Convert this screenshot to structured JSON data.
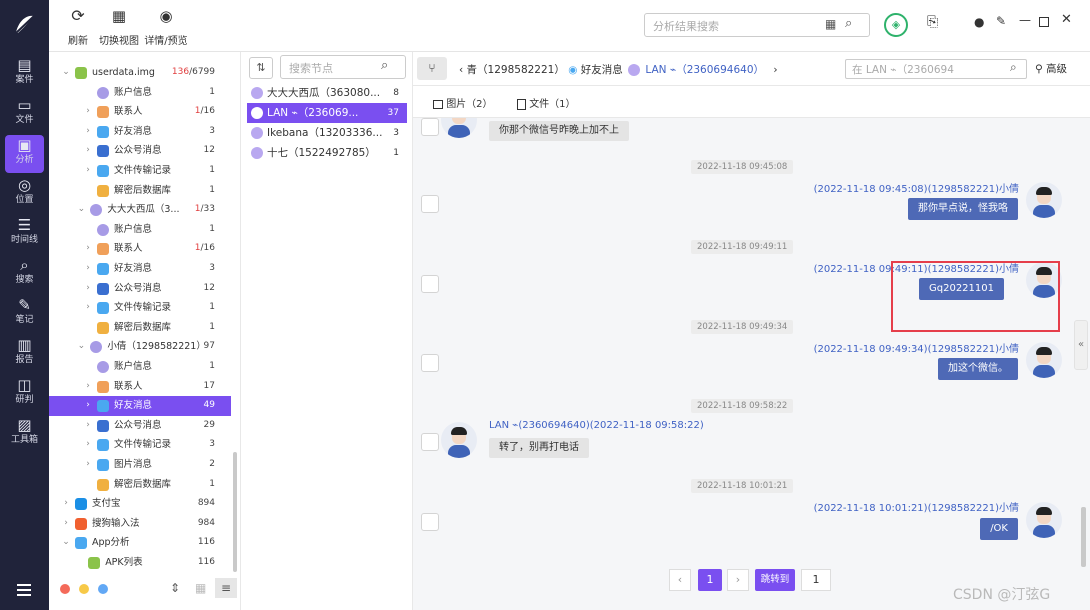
{
  "leftbar": {
    "items": [
      {
        "icon": "case-icon",
        "label": "案件"
      },
      {
        "icon": "file-icon",
        "label": "文件"
      },
      {
        "icon": "analysis-icon",
        "label": "分析"
      },
      {
        "icon": "location-icon",
        "label": "位置"
      },
      {
        "icon": "timeline-icon",
        "label": "时间线"
      },
      {
        "icon": "search-icon",
        "label": "搜索"
      },
      {
        "icon": "note-icon",
        "label": "笔记"
      },
      {
        "icon": "report-icon",
        "label": "报告"
      },
      {
        "icon": "judge-icon",
        "label": "研判"
      },
      {
        "icon": "toolbox-icon",
        "label": "工具箱"
      }
    ],
    "active_index": 2
  },
  "toolbar": {
    "refresh_label": "刷新",
    "switch_view_label": "切换视图",
    "detail_preview_label": "详情/预览",
    "search_placeholder": "分析结果搜索"
  },
  "tree": {
    "rows": [
      {
        "level": 0,
        "arrow": "v",
        "icon": "android",
        "text": "userdata.img",
        "cnt_red": "136",
        "cnt": "/6799"
      },
      {
        "level": 1,
        "arrow": "",
        "icon": "user",
        "text": "账户信息",
        "cnt": "1"
      },
      {
        "level": 1,
        "arrow": ">",
        "icon": "contact",
        "text": "联系人",
        "cnt_red": "1",
        "cnt": "/16"
      },
      {
        "level": 1,
        "arrow": ">",
        "icon": "chat",
        "text": "好友消息",
        "cnt": "3"
      },
      {
        "level": 1,
        "arrow": ">",
        "icon": "official",
        "text": "公众号消息",
        "cnt": "12"
      },
      {
        "level": 1,
        "arrow": ">",
        "icon": "chat",
        "text": "文件传输记录",
        "cnt": "1"
      },
      {
        "level": 1,
        "arrow": "",
        "icon": "db",
        "text": "解密后数据库",
        "cnt": "1"
      },
      {
        "level": 0.7,
        "arrow": "v",
        "icon": "user",
        "text": "大大大西瓜（3...",
        "cnt_red": "1",
        "cnt": "/33"
      },
      {
        "level": 1,
        "arrow": "",
        "icon": "user",
        "text": "账户信息",
        "cnt": "1"
      },
      {
        "level": 1,
        "arrow": ">",
        "icon": "contact",
        "text": "联系人",
        "cnt_red": "1",
        "cnt": "/16"
      },
      {
        "level": 1,
        "arrow": ">",
        "icon": "chat",
        "text": "好友消息",
        "cnt": "3"
      },
      {
        "level": 1,
        "arrow": ">",
        "icon": "official",
        "text": "公众号消息",
        "cnt": "12"
      },
      {
        "level": 1,
        "arrow": ">",
        "icon": "chat",
        "text": "文件传输记录",
        "cnt": "1"
      },
      {
        "level": 1,
        "arrow": "",
        "icon": "db",
        "text": "解密后数据库",
        "cnt": "1"
      },
      {
        "level": 0.7,
        "arrow": "v",
        "icon": "user",
        "text": "小倩（1298582221）",
        "cnt": "97"
      },
      {
        "level": 1,
        "arrow": "",
        "icon": "user",
        "text": "账户信息",
        "cnt": "1"
      },
      {
        "level": 1,
        "arrow": ">",
        "icon": "contact",
        "text": "联系人",
        "cnt": "17"
      },
      {
        "level": 1,
        "arrow": ">",
        "icon": "chat",
        "text": "好友消息",
        "cnt": "49",
        "selected": true
      },
      {
        "level": 1,
        "arrow": ">",
        "icon": "official",
        "text": "公众号消息",
        "cnt": "29"
      },
      {
        "level": 1,
        "arrow": ">",
        "icon": "chat",
        "text": "文件传输记录",
        "cnt": "3"
      },
      {
        "level": 1,
        "arrow": ">",
        "icon": "chat",
        "text": "图片消息",
        "cnt": "2"
      },
      {
        "level": 1,
        "arrow": "",
        "icon": "db",
        "text": "解密后数据库",
        "cnt": "1"
      },
      {
        "level": 0,
        "arrow": ">",
        "icon": "alipay",
        "text": "支付宝",
        "cnt": "894"
      },
      {
        "level": 0,
        "arrow": ">",
        "icon": "sogou",
        "text": "搜狗输入法",
        "cnt": "984"
      },
      {
        "level": 0,
        "arrow": "v",
        "icon": "app",
        "text": "App分析",
        "cnt": "116"
      },
      {
        "level": 0.6,
        "arrow": "",
        "icon": "apk",
        "text": "APK列表",
        "cnt": "116"
      }
    ]
  },
  "nodes": {
    "search_placeholder": "搜索节点",
    "items": [
      {
        "text": "大大大西瓜（363080...",
        "cnt": "8"
      },
      {
        "text": "LAN ⌁（236069...",
        "cnt": "37",
        "selected": true
      },
      {
        "text": "Ikebana（13203336...",
        "cnt": "3"
      },
      {
        "text": "十七（1522492785）",
        "cnt": "1"
      }
    ]
  },
  "breadcrumb": {
    "item1": "青（1298582221）",
    "item2": "好友消息",
    "item3": "LAN ⌁（2360694640）",
    "in_search": "在 LAN ⌁（2360694",
    "advanced": "高级"
  },
  "tabs": [
    {
      "label": "图片（2）"
    },
    {
      "label": "文件（1）"
    }
  ],
  "messages": {
    "m0_text": "你那个微信号昨晚上加不上",
    "t1": "2022-11-18 09:45:08",
    "m1_sender": "(2022-11-18 09:45:08)(1298582221)小倩",
    "m1_text": "那你早点说，怪我咯",
    "t2": "2022-11-18 09:49:11",
    "m2_sender": "(2022-11-18 09:49:11)(1298582221)小倩",
    "m2_text": "Gq20221101",
    "t3": "2022-11-18 09:49:34",
    "m3_sender": "(2022-11-18 09:49:34)(1298582221)小倩",
    "m3_text": "加这个微信。",
    "t4": "2022-11-18 09:58:22",
    "m4_sender": "LAN ⌁(2360694640)(2022-11-18 09:58:22)",
    "m4_text": "转了，别再打电话",
    "t5": "2022-11-18 10:01:21",
    "m5_sender": "(2022-11-18 10:01:21)(1298582221)小倩",
    "m5_text": "/OK"
  },
  "pager": {
    "current": "1",
    "jump_label": "跳转到",
    "jump_value": "1"
  },
  "watermark": "CSDN @汀弦G",
  "colors": {
    "accent": "#7a4ff0",
    "sidebar_bg": "#20233a",
    "bubble_right": "#4e69b6",
    "highlight_box": "#e53e4b"
  }
}
